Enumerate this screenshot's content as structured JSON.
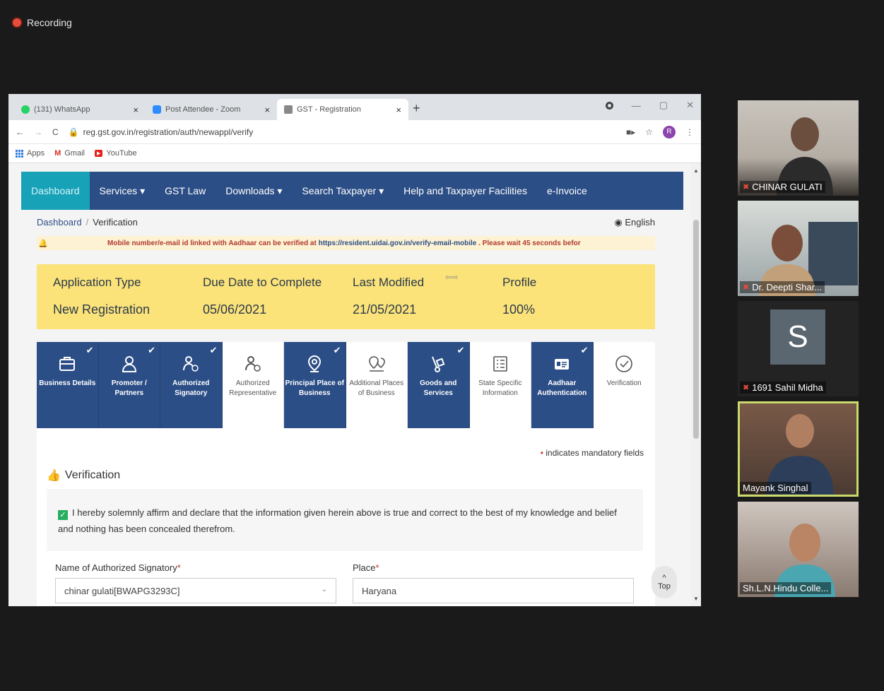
{
  "recording": {
    "label": "Recording"
  },
  "browser": {
    "tabs": [
      {
        "title": "(131) WhatsApp",
        "icon_color": "#25d366",
        "active": false
      },
      {
        "title": "Post Attendee - Zoom",
        "icon_color": "#2d8cff",
        "active": false
      },
      {
        "title": "GST - Registration",
        "icon_color": "#888888",
        "active": true
      }
    ],
    "new_tab": "+",
    "url": "reg.gst.gov.in/registration/auth/newappl/verify",
    "profile_initial": "R",
    "bookmarks": [
      {
        "label": "Apps",
        "icon": "apps-grid-icon"
      },
      {
        "label": "Gmail",
        "icon": "gmail-icon"
      },
      {
        "label": "YouTube",
        "icon": "youtube-icon"
      }
    ]
  },
  "nav": {
    "items": [
      "Dashboard",
      "Services ▾",
      "GST Law",
      "Downloads ▾",
      "Search Taxpayer ▾",
      "Help and Taxpayer Facilities",
      "e-Invoice"
    ],
    "active_index": 0
  },
  "breadcrumb": {
    "home": "Dashboard",
    "current": "Verification"
  },
  "language": "English",
  "alert": {
    "prefix": "Mobile number/e-mail id linked with Aadhaar can be verified at",
    "link": "https://resident.uidai.gov.in/verify-email-mobile",
    "suffix": ". Please wait 45 seconds befor"
  },
  "application": {
    "labels": [
      "Application Type",
      "Due Date to Complete",
      "Last Modified",
      "Profile"
    ],
    "values": [
      "New Registration",
      "05/06/2021",
      "21/05/2021",
      "100%"
    ]
  },
  "steps": [
    {
      "label": "Business Details",
      "status": "done",
      "icon": "briefcase-icon"
    },
    {
      "label": "Promoter / Partners",
      "status": "done",
      "icon": "person-icon"
    },
    {
      "label": "Authorized Signatory",
      "status": "done",
      "icon": "signatory-icon"
    },
    {
      "label": "Authorized Representative",
      "status": "todo",
      "icon": "representative-icon"
    },
    {
      "label": "Principal Place of Business",
      "status": "done",
      "icon": "location-pin-icon"
    },
    {
      "label": "Additional Places of Business",
      "status": "todo",
      "icon": "multi-location-icon"
    },
    {
      "label": "Goods and Services",
      "status": "done",
      "icon": "hand-truck-icon"
    },
    {
      "label": "State Specific Information",
      "status": "todo",
      "icon": "info-list-icon"
    },
    {
      "label": "Aadhaar Authentication",
      "status": "done",
      "icon": "id-card-icon"
    },
    {
      "label": "Verification",
      "status": "todo",
      "icon": "check-circle-icon"
    }
  ],
  "form": {
    "mandatory_note": "indicates mandatory fields",
    "section_title": "Verification",
    "declaration": "I hereby solemnly affirm and declare that the information given herein above is true and correct to the best of my knowledge and belief and nothing has been concealed therefrom.",
    "signatory_label": "Name of Authorized Signatory",
    "signatory_value": "chinar gulati[BWAPG3293C]",
    "place_label": "Place",
    "place_value": "Haryana"
  },
  "top_button": "Top",
  "participants": [
    {
      "name": "CHINAR GULATI",
      "muted": true
    },
    {
      "name": "Dr. Deepti Shar...",
      "muted": true
    },
    {
      "name": "1691 Sahil Midha",
      "muted": true,
      "initial": "S"
    },
    {
      "name": "Mayank Singhal",
      "muted": false
    },
    {
      "name": "Sh.L.N.Hindu Colle...",
      "muted": false
    }
  ]
}
